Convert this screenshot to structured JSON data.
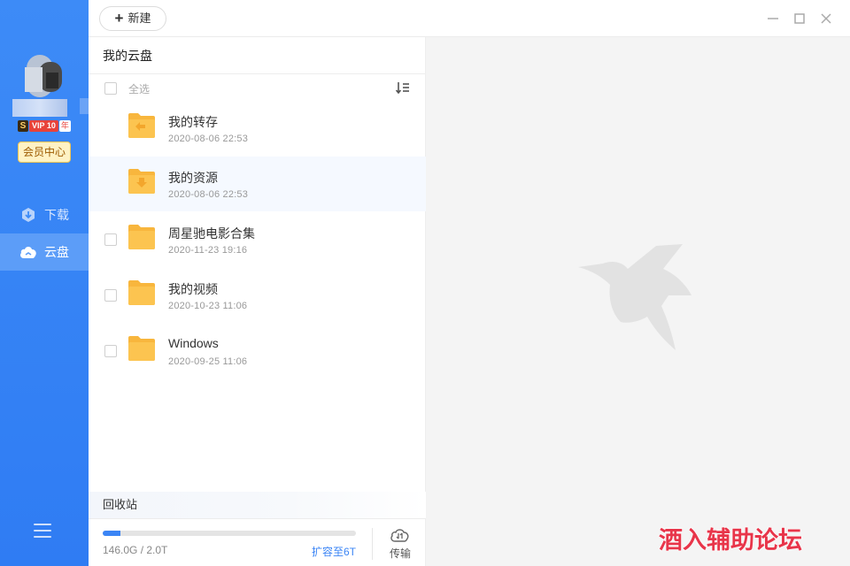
{
  "sidebar": {
    "vip": {
      "s_badge": "S",
      "label": "VIP 10",
      "year": "年"
    },
    "member_center": "会员中心",
    "nav": [
      {
        "label": "下载",
        "icon": "download-icon"
      },
      {
        "label": "云盘",
        "icon": "cloud-icon"
      }
    ]
  },
  "toolbar": {
    "new_label": "新建"
  },
  "panel": {
    "title": "我的云盘",
    "select_all": "全选",
    "files": [
      {
        "name": "我的转存",
        "date": "2020-08-06 22:53"
      },
      {
        "name": "我的资源",
        "date": "2020-08-06 22:53"
      },
      {
        "name": "周星驰电影合集",
        "date": "2020-11-23 19:16"
      },
      {
        "name": "我的视频",
        "date": "2020-10-23 11:06"
      },
      {
        "name": "Windows",
        "date": "2020-09-25 11:06"
      }
    ],
    "recycle": "回收站",
    "storage": {
      "used_text": "146.0G / 2.0T",
      "expand": "扩容至6T",
      "transfer": "传输",
      "used_fraction": 0.071
    }
  },
  "watermark": "酒入辅助论坛",
  "colors": {
    "accent": "#3b85f5",
    "sidebar": "#3d8bf7",
    "folder": "#f8b63d"
  }
}
